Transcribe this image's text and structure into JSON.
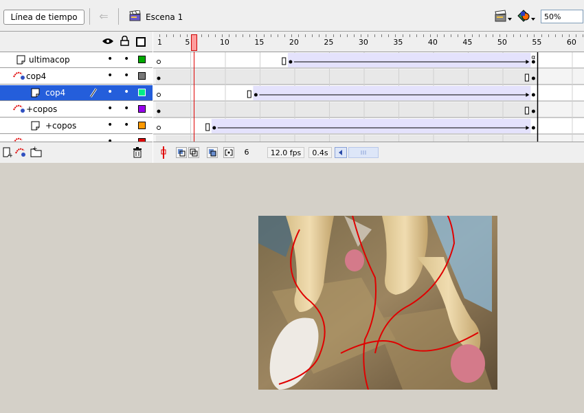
{
  "toolbar": {
    "timeline_button": "Línea de tiempo",
    "scene_label": "Escena 1",
    "zoom_value": "50%",
    "icons": [
      "back-arrow-icon",
      "scene-clapper-icon",
      "edit-scene-icon",
      "edit-symbol-icon"
    ]
  },
  "layer_header": {
    "icons": [
      "eye-icon",
      "lock-icon",
      "outline-icon"
    ]
  },
  "ruler": {
    "labels": [
      "1",
      "5",
      "10",
      "15",
      "20",
      "25",
      "30",
      "35",
      "40",
      "45",
      "50",
      "55",
      "60"
    ]
  },
  "layers": [
    {
      "name": "ultimacop",
      "type": "normal",
      "color": "#00aa00",
      "selected": false
    },
    {
      "name": "cop4",
      "type": "guide",
      "color": "#777777",
      "selected": false
    },
    {
      "name": "cop4",
      "type": "guided",
      "color": "#00ee88",
      "selected": true
    },
    {
      "name": "+copos",
      "type": "guide",
      "color": "#9900ee",
      "selected": false
    },
    {
      "name": "+copos",
      "type": "guided",
      "color": "#ff9900",
      "selected": false
    }
  ],
  "status": {
    "current_frame": "6",
    "frame_rate": "12.0 fps",
    "elapsed": "0.4s"
  },
  "playhead_frame": 6,
  "tweens": [
    {
      "row": 0,
      "blank_to": 19,
      "start": 20,
      "end": 55
    },
    {
      "row": 2,
      "blank_to": 14,
      "start": 15,
      "end": 55
    },
    {
      "row": 4,
      "blank_to": 8,
      "start": 9,
      "end": 55
    }
  ]
}
